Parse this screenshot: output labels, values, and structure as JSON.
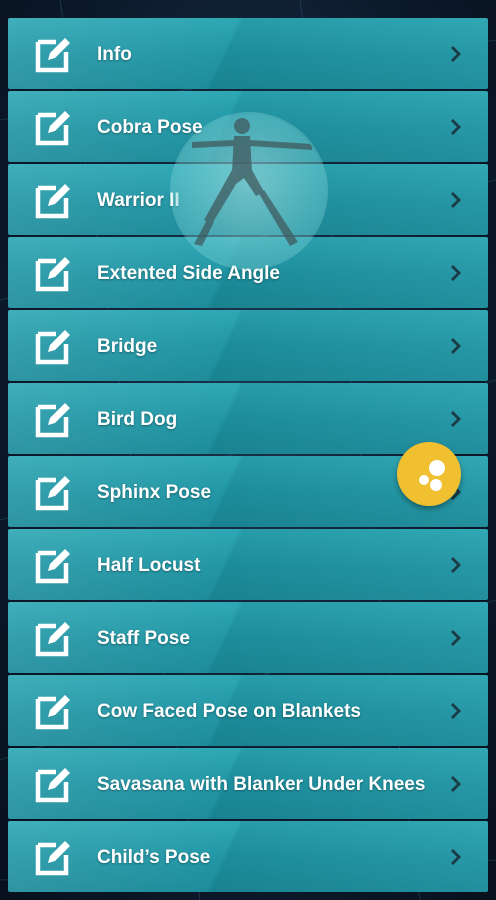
{
  "menu": {
    "items": [
      {
        "label": "Info"
      },
      {
        "label": "Cobra Pose"
      },
      {
        "label": "Warrior II"
      },
      {
        "label": "Extented Side Angle"
      },
      {
        "label": "Bridge"
      },
      {
        "label": "Bird Dog"
      },
      {
        "label": "Sphinx Pose"
      },
      {
        "label": "Half Locust"
      },
      {
        "label": "Staff Pose"
      },
      {
        "label": "Cow Faced Pose on Blankets"
      },
      {
        "label": "Savasana with Blanker Under Knees"
      },
      {
        "label": "Child’s Pose"
      }
    ]
  },
  "icons": {
    "row_icon": "edit-icon",
    "row_chevron": "chevron-right-icon",
    "fab_icon": "bubbles-icon"
  },
  "colors": {
    "row_teal": "#1f95a4",
    "fab_yellow": "#f0c030",
    "text": "#ffffff",
    "background": "#0d1a2c"
  }
}
